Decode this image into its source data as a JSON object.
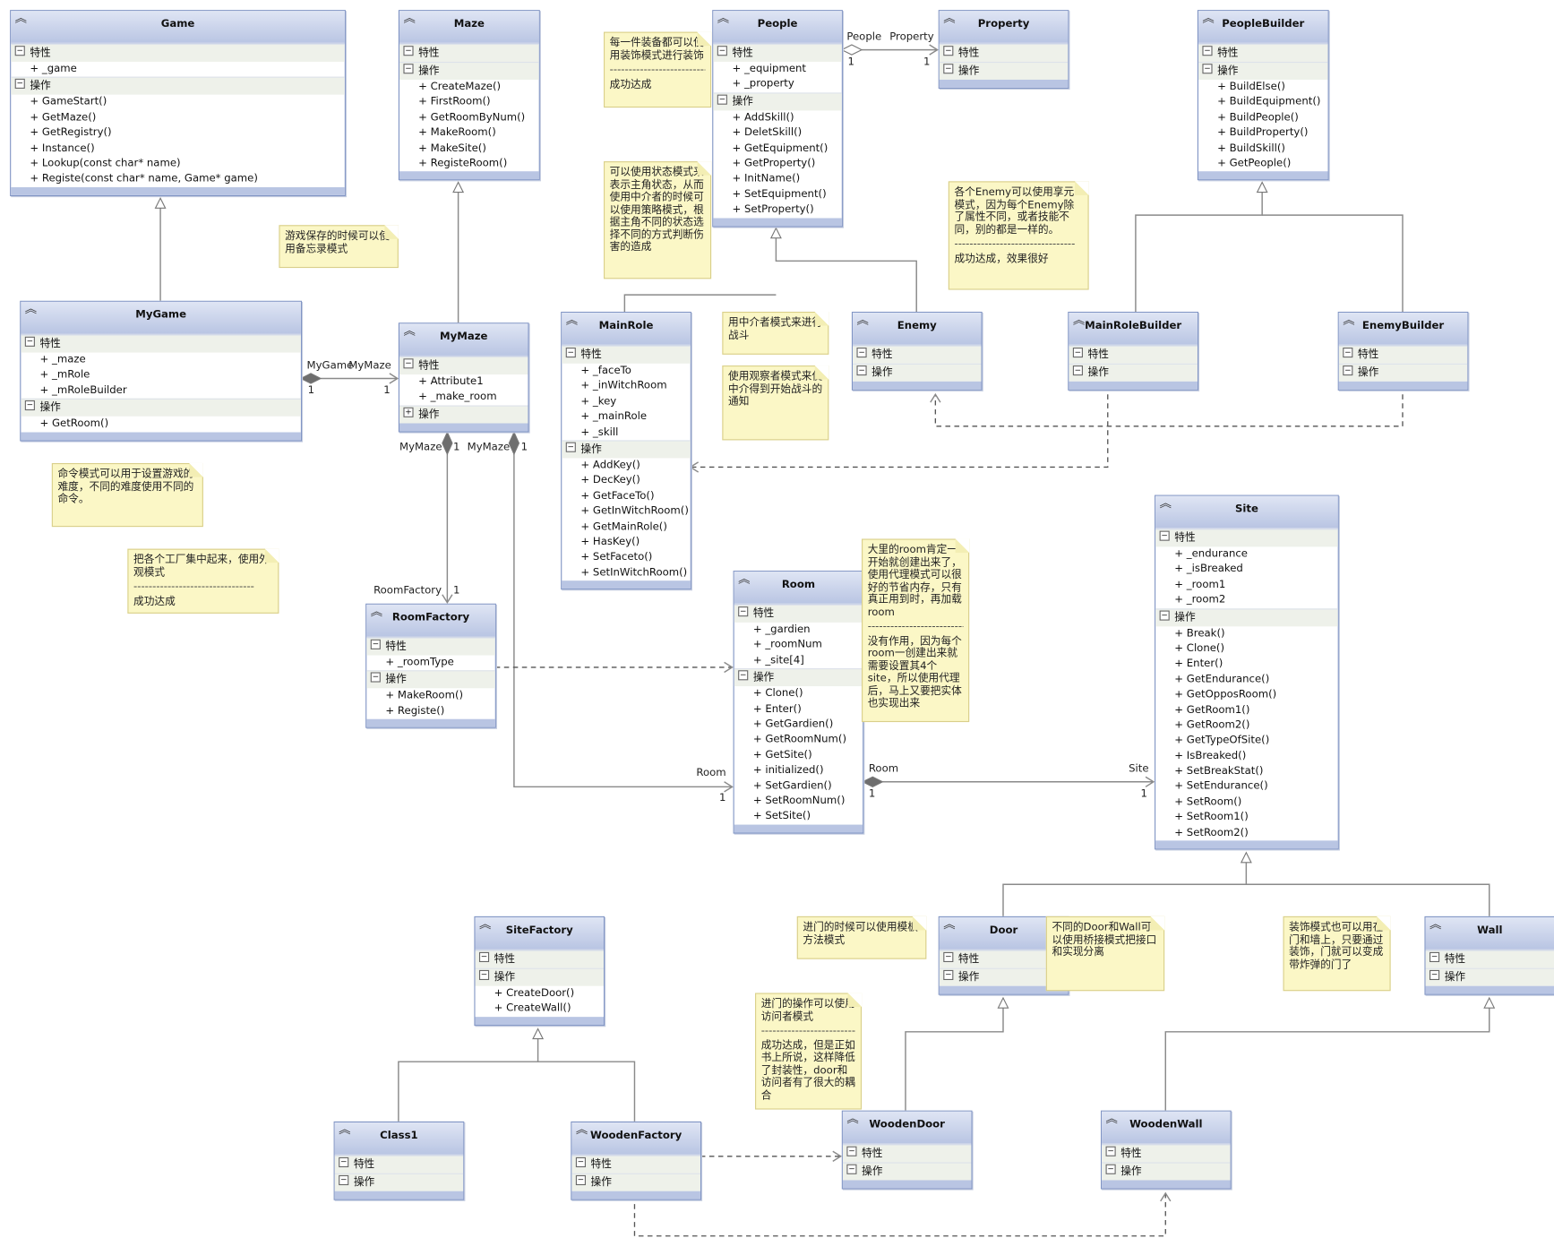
{
  "icons": {
    "class_header": "double-chevron-up-icon",
    "section_expanded": "collapse-minus-icon",
    "section_collapsed": "expand-plus-icon"
  },
  "colors": {
    "class_header": "#b9c5e3",
    "class_border": "#8094c4",
    "section_bg": "#eef1ea",
    "note_bg": "#fbf7c6",
    "line": "#888888"
  },
  "section_labels": {
    "attributes": "特性",
    "operations": "操作"
  },
  "classes": [
    {
      "id": "Game",
      "name": "Game",
      "attributes": [
        "_game"
      ],
      "operations": [
        "GameStart()",
        "GetMaze()",
        "GetRegistry()",
        "Instance()",
        "Lookup(const char* name)",
        "Registe(const char* name, Game* game)"
      ]
    },
    {
      "id": "Maze",
      "name": "Maze",
      "attributes": [],
      "operations": [
        "CreateMaze()",
        "FirstRoom()",
        "GetRoomByNum()",
        "MakeRoom()",
        "MakeSite()",
        "RegisteRoom()"
      ]
    },
    {
      "id": "People",
      "name": "People",
      "attributes": [
        "_equipment",
        "_property"
      ],
      "operations": [
        "AddSkill()",
        "DeletSkill()",
        "GetEquipment()",
        "GetProperty()",
        "InitName()",
        "SetEquipment()",
        "SetProperty()"
      ]
    },
    {
      "id": "Property",
      "name": "Property",
      "attributes": [],
      "operations": []
    },
    {
      "id": "PeopleBuilder",
      "name": "PeopleBuilder",
      "attributes": [],
      "operations": [
        "BuildElse()",
        "BuildEquipment()",
        "BuildPeople()",
        "BuildProperty()",
        "BuildSkill()",
        "GetPeople()"
      ]
    },
    {
      "id": "MyGame",
      "name": "MyGame",
      "attributes": [
        "_maze",
        "_mRole",
        "_mRoleBuilder"
      ],
      "operations": [
        "GetRoom()"
      ]
    },
    {
      "id": "MyMaze",
      "name": "MyMaze",
      "attributes": [
        "Attribute1",
        "_make_room"
      ],
      "operations": [],
      "operations_collapsed": true
    },
    {
      "id": "MainRole",
      "name": "MainRole",
      "attributes": [
        "_faceTo",
        "_inWitchRoom",
        "_key",
        "_mainRole",
        "_skill"
      ],
      "operations": [
        "AddKey()",
        "DecKey()",
        "GetFaceTo()",
        "GetInWitchRoom()",
        "GetMainRole()",
        "HasKey()",
        "SetFaceto()",
        "SetInWitchRoom()"
      ]
    },
    {
      "id": "Enemy",
      "name": "Enemy",
      "attributes": [],
      "operations": []
    },
    {
      "id": "MainRoleBuilder",
      "name": "MainRoleBuilder",
      "attributes": [],
      "operations": []
    },
    {
      "id": "EnemyBuilder",
      "name": "EnemyBuilder",
      "attributes": [],
      "operations": []
    },
    {
      "id": "RoomFactory",
      "name": "RoomFactory",
      "attributes": [
        "_roomType"
      ],
      "operations": [
        "MakeRoom()",
        "Registe()"
      ]
    },
    {
      "id": "Room",
      "name": "Room",
      "attributes": [
        "_gardien",
        "_roomNum",
        "_site[4]"
      ],
      "operations": [
        "Clone()",
        "Enter()",
        "GetGardien()",
        "GetRoomNum()",
        "GetSite()",
        "initialized()",
        "SetGardien()",
        "SetRoomNum()",
        "SetSite()"
      ]
    },
    {
      "id": "Site",
      "name": "Site",
      "attributes": [
        "_endurance",
        "_isBreaked",
        "_room1",
        "_room2"
      ],
      "operations": [
        "Break()",
        "Clone()",
        "Enter()",
        "GetEndurance()",
        "GetOpposRoom()",
        "GetRoom1()",
        "GetRoom2()",
        "GetTypeOfSite()",
        "IsBreaked()",
        "SetBreakStat()",
        "SetEndurance()",
        "SetRoom()",
        "SetRoom1()",
        "SetRoom2()"
      ]
    },
    {
      "id": "SiteFactory",
      "name": "SiteFactory",
      "attributes": [],
      "operations": [
        "CreateDoor()",
        "CreateWall()"
      ]
    },
    {
      "id": "Door",
      "name": "Door",
      "attributes": [],
      "operations": []
    },
    {
      "id": "Wall",
      "name": "Wall",
      "attributes": [],
      "operations": []
    },
    {
      "id": "Class1",
      "name": "Class1",
      "attributes": [],
      "operations": []
    },
    {
      "id": "WoodenFactory",
      "name": "WoodenFactory",
      "attributes": [],
      "operations": []
    },
    {
      "id": "WoodenDoor",
      "name": "WoodenDoor",
      "attributes": [],
      "operations": []
    },
    {
      "id": "WoodenWall",
      "name": "WoodenWall",
      "attributes": [],
      "operations": []
    }
  ],
  "notes": [
    {
      "id": "n_decorator",
      "parts": [
        "每一件装备都可以使用装饰模式进行装饰",
        "----------------------------",
        "成功达成"
      ]
    },
    {
      "id": "n_state",
      "parts": [
        "可以使用状态模式来表示主角状态，从而使用中介者的时候可以使用策略模式，根据主角不同的状态选择不同的方式判断伤害的造成"
      ]
    },
    {
      "id": "n_memento",
      "parts": [
        "游戏保存的时候可以使用备忘录模式"
      ]
    },
    {
      "id": "n_flyweight",
      "parts": [
        "各个Enemy可以使用享元模式，因为每个Enemy除了属性不同，或者技能不同，别的都是一样的。",
        "--------------------------------",
        "成功达成，效果很好"
      ]
    },
    {
      "id": "n_mediator",
      "parts": [
        "用中介者模式来进行战斗"
      ]
    },
    {
      "id": "n_observer",
      "parts": [
        "使用观察者模式来使中介得到开始战斗的通知"
      ]
    },
    {
      "id": "n_command",
      "parts": [
        "命令模式可以用于设置游戏的难度，不同的难度使用不同的命令。"
      ]
    },
    {
      "id": "n_facade",
      "parts": [
        "把各个工厂集中起来，使用外观模式",
        "--------------------------------",
        "成功达成"
      ]
    },
    {
      "id": "n_proxy",
      "parts": [
        "大里的room肯定一开始就创建出来了，使用代理模式可以很好的节省内存，只有真正用到时，再加载room",
        "--------------------------",
        "没有作用，因为每个room一创建出来就需要设置其4个site，所以使用代理后，马上又要把实体也实现出来"
      ]
    },
    {
      "id": "n_template",
      "parts": [
        "进门的时候可以使用模板方法模式"
      ]
    },
    {
      "id": "n_bridge",
      "parts": [
        "不同的Door和Wall可以使用桥接模式把接口和实现分离"
      ]
    },
    {
      "id": "n_decorator2",
      "parts": [
        "装饰模式也可以用在门和墙上，只要通过装饰，门就可以变成带炸弹的门了"
      ]
    },
    {
      "id": "n_visitor",
      "parts": [
        "进门的操作可以使用访问者模式",
        "--------------------------",
        "成功达成，但是正如书上所说，这样降低了封装性，door和访问者有了很大的耦合"
      ]
    }
  ],
  "associations": [
    {
      "id": "people_property",
      "type": "aggregation",
      "from": "People",
      "to": "Property",
      "from_role": "People",
      "to_role": "Property",
      "from_mult": "1",
      "to_mult": "1"
    },
    {
      "id": "mygame_mymaze",
      "type": "composition",
      "from": "MyGame",
      "to": "MyMaze",
      "from_role": "MyGame",
      "to_role": "MyMaze",
      "from_mult": "1",
      "to_mult": "1"
    },
    {
      "id": "mymaze_roomfactory",
      "type": "composition",
      "from": "MyMaze",
      "to": "RoomFactory",
      "from_role": "MyMaze",
      "to_role": "RoomFactory",
      "from_mult": "1",
      "to_mult": "1"
    },
    {
      "id": "mymaze_room",
      "type": "composition",
      "from": "MyMaze",
      "to": "Room",
      "from_role": "MyMaze",
      "to_role": "Room",
      "from_mult": "1",
      "to_mult": "1"
    },
    {
      "id": "room_site",
      "type": "composition",
      "from": "Room",
      "to": "Site",
      "from_role": "Room",
      "to_role": "Site",
      "from_mult": "1",
      "to_mult": "1"
    }
  ]
}
